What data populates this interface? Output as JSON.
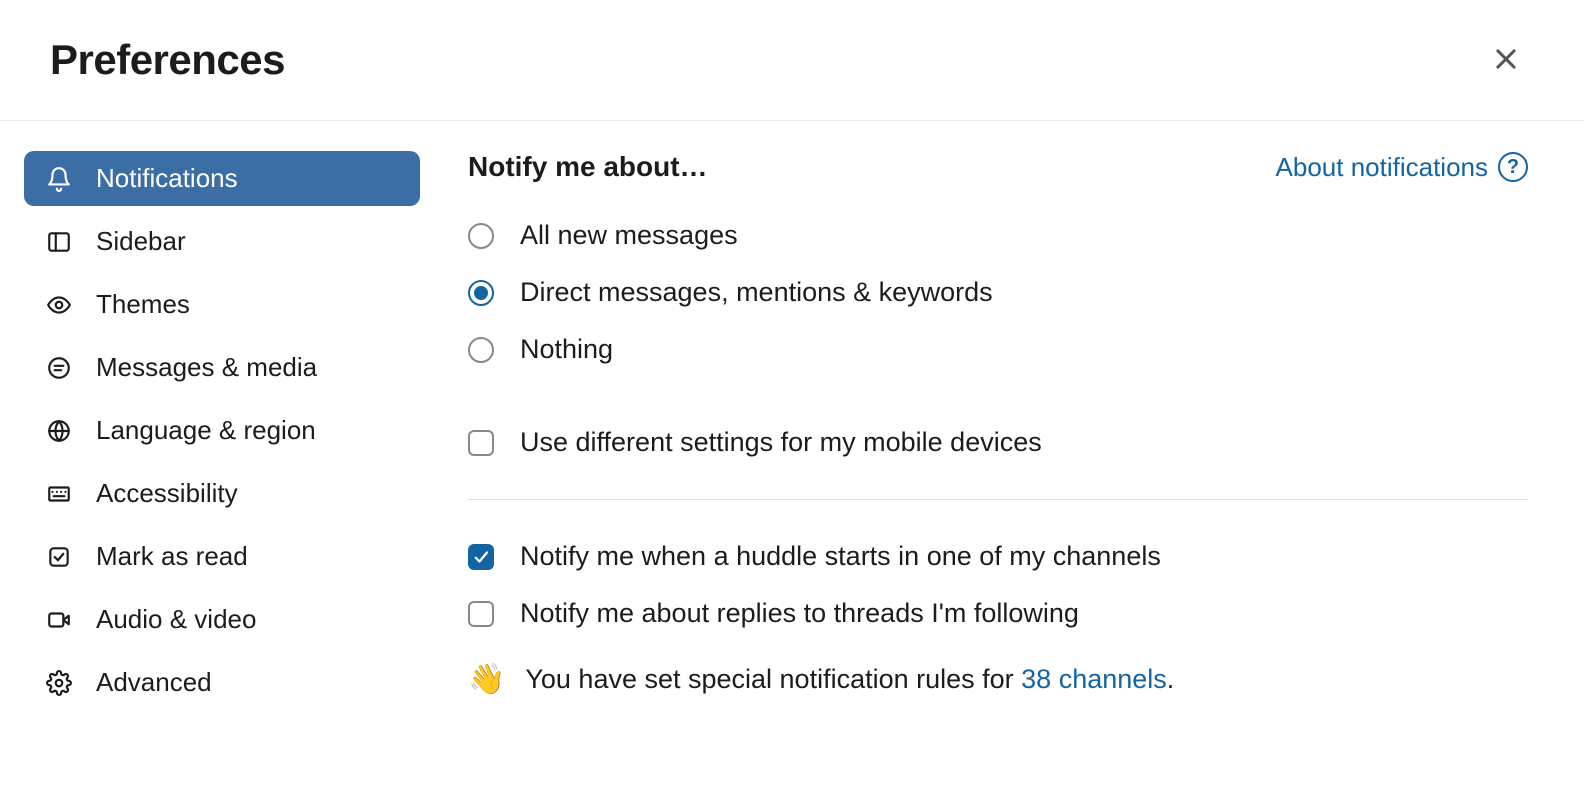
{
  "header": {
    "title": "Preferences"
  },
  "sidebar": {
    "items": [
      {
        "label": "Notifications",
        "active": true
      },
      {
        "label": "Sidebar"
      },
      {
        "label": "Themes"
      },
      {
        "label": "Messages & media"
      },
      {
        "label": "Language & region"
      },
      {
        "label": "Accessibility"
      },
      {
        "label": "Mark as read"
      },
      {
        "label": "Audio & video"
      },
      {
        "label": "Advanced"
      }
    ]
  },
  "content": {
    "section_title": "Notify me about…",
    "about_link": "About notifications",
    "radio_options": [
      {
        "label": "All new messages",
        "selected": false
      },
      {
        "label": "Direct messages, mentions & keywords",
        "selected": true
      },
      {
        "label": "Nothing",
        "selected": false
      }
    ],
    "mobile_checkbox": {
      "label": "Use different settings for my mobile devices",
      "checked": false
    },
    "extra_checks": [
      {
        "label": "Notify me when a huddle starts in one of my channels",
        "checked": true
      },
      {
        "label": "Notify me about replies to threads I'm following",
        "checked": false
      }
    ],
    "special_rules": {
      "prefix": "You have set special notification rules for ",
      "link": "38 channels",
      "suffix": "."
    }
  }
}
